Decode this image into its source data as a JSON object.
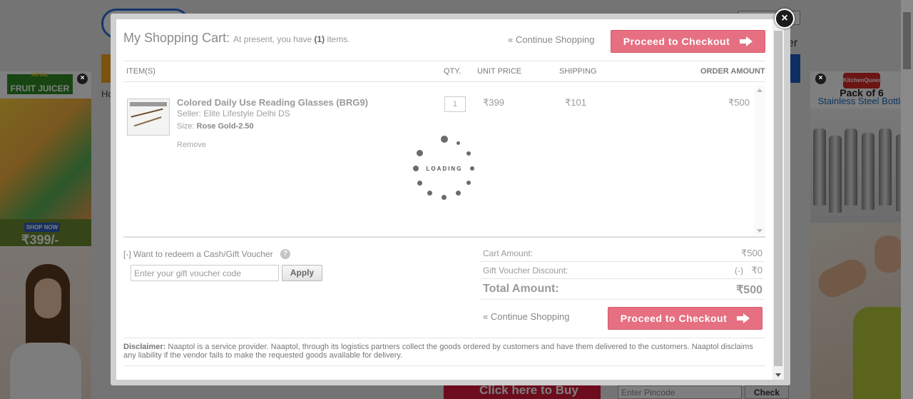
{
  "background": {
    "header_partial_text": "er",
    "home_partial": "Ho",
    "buy_button": "Click here to Buy",
    "pincode_placeholder": "Enter Pincode",
    "check_button": "Check"
  },
  "ad_left": {
    "brand_top": "ROYAL",
    "brand": "FRUIT JUICER",
    "shop_now": "SHOP NOW",
    "price": "₹399/-"
  },
  "ad_right": {
    "brand": "KitchenQueen",
    "headline": "Pack of 6",
    "subline": "Stainless Steel Bottle"
  },
  "cart": {
    "title": "My Shopping Cart:",
    "subtitle_prefix": "At present, you have",
    "item_count": "(1)",
    "subtitle_suffix": "items.",
    "continue_shopping": "« Continue Shopping",
    "checkout_label": "Proceed to Checkout",
    "columns": {
      "items": "ITEM(S)",
      "qty": "QTY.",
      "unit_price": "UNIT PRICE",
      "shipping": "SHIPPING",
      "order_amount": "ORDER AMOUNT"
    },
    "items": [
      {
        "name": "Colored Daily Use Reading Glasses (BRG9)",
        "seller": "Seller: Elite Lifestyle Delhi DS",
        "size_label": "Size:",
        "size_value": "Rose Gold-2.50",
        "remove": "Remove",
        "qty": "1",
        "unit_price": "₹399",
        "shipping": "₹101",
        "order_amount": "₹500"
      }
    ],
    "loading_text": "LOADING",
    "voucher": {
      "toggle": "[-] Want to redeem a Cash/Gift Voucher",
      "help": "?",
      "placeholder": "Enter your gift voucher code",
      "apply": "Apply"
    },
    "summary": {
      "cart_amount_label": "Cart Amount:",
      "cart_amount_value": "₹500",
      "discount_label": "Gift Voucher Discount:",
      "discount_sign": "(-)",
      "discount_value": "₹0",
      "total_label": "Total Amount:",
      "total_value": "₹500"
    },
    "disclaimer_label": "Disclaimer:",
    "disclaimer_text": "Naaptol is a service provider. Naaptol, through its logistics partners collect the goods ordered by customers and have them delivered to the customers. Naaptol disclaims any liability if the vendor fails to make the requested goods available for delivery."
  },
  "icons": {
    "close": "×",
    "ad_close": "×"
  }
}
